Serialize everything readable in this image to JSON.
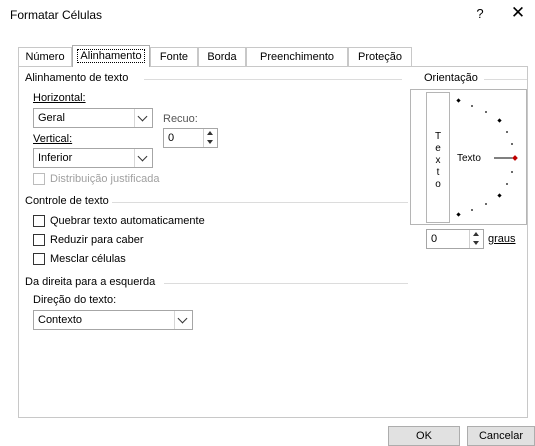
{
  "window": {
    "title": "Formatar Células",
    "help": "?",
    "close": "✕"
  },
  "tabs": [
    {
      "label": "Número"
    },
    {
      "label": "Alinhamento"
    },
    {
      "label": "Fonte"
    },
    {
      "label": "Borda"
    },
    {
      "label": "Preenchimento"
    },
    {
      "label": "Proteção"
    }
  ],
  "active_tab": "Alinhamento",
  "text_alignment": {
    "group_label": "Alinhamento de texto",
    "horizontal_label": "Horizontal:",
    "horizontal_value": "Geral",
    "indent_label": "Recuo:",
    "indent_value": "0",
    "vertical_label": "Vertical:",
    "vertical_value": "Inferior",
    "justify_distributed": "Distribuição justificada"
  },
  "text_control": {
    "group_label": "Controle de texto",
    "wrap_text": "Quebrar texto automaticamente",
    "shrink_to_fit": "Reduzir para caber",
    "merge_cells": "Mesclar células"
  },
  "rtl": {
    "group_label": "Da direita para a esquerda",
    "direction_label": "Direção do texto:",
    "direction_value": "Contexto"
  },
  "orientation": {
    "group_label": "Orientação",
    "vertical_text": [
      "T",
      "e",
      "x",
      "t",
      "o"
    ],
    "dial_text": "Texto",
    "degrees_value": "0",
    "degrees_label": "graus"
  },
  "buttons": {
    "ok": "OK",
    "cancel": "Cancelar"
  },
  "colors": {
    "accent_marker": "#c00000",
    "border": "#c8c8c8"
  }
}
